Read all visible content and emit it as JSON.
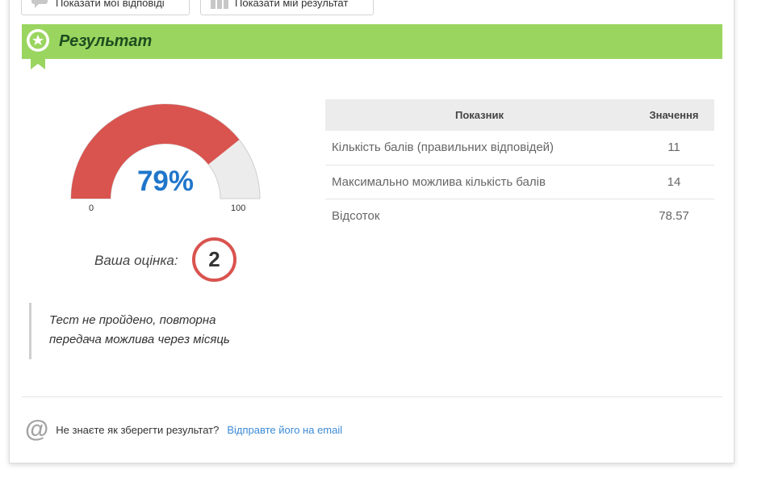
{
  "top_buttons": {
    "answers_label": "Показати мої відповіді",
    "results_label": "Показати мій результат"
  },
  "result_header": {
    "title": "Результат"
  },
  "gauge": {
    "value_text": "79%",
    "percent": 78.57,
    "min": "0",
    "max": "100"
  },
  "grade": {
    "label": "Ваша оцінка:",
    "value": "2"
  },
  "note": {
    "line1": "Тест не пройдено, повторна",
    "line2": "передача можлива через місяць"
  },
  "stats_table": {
    "headers": [
      "Показник",
      "Значення"
    ],
    "rows": [
      [
        "Кількість балів (правильних відповідей)",
        "11"
      ],
      [
        "Максимально можлива кількість балів",
        "14"
      ],
      [
        "Відсоток",
        "78.57"
      ]
    ]
  },
  "email": {
    "question": "Не знаєте як зберегти результат?",
    "link": "Відправте його на email"
  },
  "colors": {
    "green_bar": "#9ad560",
    "gauge_fill": "#d9534f",
    "gauge_track": "#ececec",
    "percent_text": "#1f76cb",
    "link": "#3d8bd6"
  }
}
